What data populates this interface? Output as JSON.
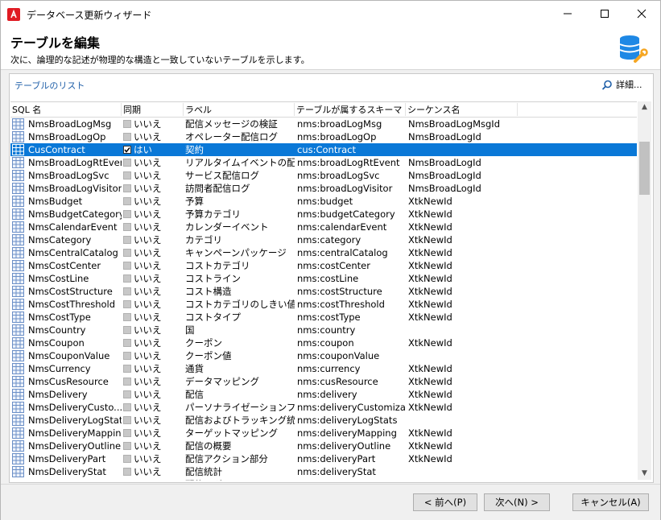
{
  "window": {
    "title": "データベース更新ウィザード",
    "accent_color": "#0a78d7",
    "app_icon": "adobe-icon"
  },
  "header": {
    "title": "テーブルを編集",
    "subtitle": "次に、論理的な記述が物理的な構造と一致していないテーブルを示します。",
    "icon": "database-wrench-icon"
  },
  "panel": {
    "list_label": "テーブルのリスト",
    "detail_label": "詳細...",
    "columns": [
      "SQL 名",
      "同期",
      "ラベル",
      "テーブルが属するスキーマ",
      "シーケンス名"
    ],
    "rows": [
      {
        "sql": "NmsBroadLogMsg",
        "sync": "いいえ",
        "checked": false,
        "label": "配信メッセージの検証",
        "schema": "nms:broadLogMsg",
        "seq": "NmsBroadLogMsgId"
      },
      {
        "sql": "NmsBroadLogOp",
        "sync": "いいえ",
        "checked": false,
        "label": "オペレーター配信ログ",
        "schema": "nms:broadLogOp",
        "seq": "NmsBroadLogId"
      },
      {
        "sql": "CusContract",
        "sync": "はい",
        "checked": true,
        "label": "契約",
        "schema": "cus:Contract",
        "seq": "",
        "selected": true
      },
      {
        "sql": "NmsBroadLogRtEvent",
        "sync": "いいえ",
        "checked": false,
        "label": "リアルタイムイベントの配...",
        "schema": "nms:broadLogRtEvent",
        "seq": "NmsBroadLogId"
      },
      {
        "sql": "NmsBroadLogSvc",
        "sync": "いいえ",
        "checked": false,
        "label": "サービス配信ログ",
        "schema": "nms:broadLogSvc",
        "seq": "NmsBroadLogId"
      },
      {
        "sql": "NmsBroadLogVisitor",
        "sync": "いいえ",
        "checked": false,
        "label": "訪問者配信ログ",
        "schema": "nms:broadLogVisitor",
        "seq": "NmsBroadLogId"
      },
      {
        "sql": "NmsBudget",
        "sync": "いいえ",
        "checked": false,
        "label": "予算",
        "schema": "nms:budget",
        "seq": "XtkNewId"
      },
      {
        "sql": "NmsBudgetCategory",
        "sync": "いいえ",
        "checked": false,
        "label": "予算カテゴリ",
        "schema": "nms:budgetCategory",
        "seq": "XtkNewId"
      },
      {
        "sql": "NmsCalendarEvent",
        "sync": "いいえ",
        "checked": false,
        "label": "カレンダーイベント",
        "schema": "nms:calendarEvent",
        "seq": "XtkNewId"
      },
      {
        "sql": "NmsCategory",
        "sync": "いいえ",
        "checked": false,
        "label": "カテゴリ",
        "schema": "nms:category",
        "seq": "XtkNewId"
      },
      {
        "sql": "NmsCentralCatalog",
        "sync": "いいえ",
        "checked": false,
        "label": "キャンペーンパッケージ",
        "schema": "nms:centralCatalog",
        "seq": "XtkNewId"
      },
      {
        "sql": "NmsCostCenter",
        "sync": "いいえ",
        "checked": false,
        "label": "コストカテゴリ",
        "schema": "nms:costCenter",
        "seq": "XtkNewId"
      },
      {
        "sql": "NmsCostLine",
        "sync": "いいえ",
        "checked": false,
        "label": "コストライン",
        "schema": "nms:costLine",
        "seq": "XtkNewId"
      },
      {
        "sql": "NmsCostStructure",
        "sync": "いいえ",
        "checked": false,
        "label": "コスト構造",
        "schema": "nms:costStructure",
        "seq": "XtkNewId"
      },
      {
        "sql": "NmsCostThreshold",
        "sync": "いいえ",
        "checked": false,
        "label": "コストカテゴリのしきい値",
        "schema": "nms:costThreshold",
        "seq": "XtkNewId"
      },
      {
        "sql": "NmsCostType",
        "sync": "いいえ",
        "checked": false,
        "label": "コストタイプ",
        "schema": "nms:costType",
        "seq": "XtkNewId"
      },
      {
        "sql": "NmsCountry",
        "sync": "いいえ",
        "checked": false,
        "label": "国",
        "schema": "nms:country",
        "seq": ""
      },
      {
        "sql": "NmsCoupon",
        "sync": "いいえ",
        "checked": false,
        "label": "クーポン",
        "schema": "nms:coupon",
        "seq": "XtkNewId"
      },
      {
        "sql": "NmsCouponValue",
        "sync": "いいえ",
        "checked": false,
        "label": "クーポン値",
        "schema": "nms:couponValue",
        "seq": ""
      },
      {
        "sql": "NmsCurrency",
        "sync": "いいえ",
        "checked": false,
        "label": "通貨",
        "schema": "nms:currency",
        "seq": "XtkNewId"
      },
      {
        "sql": "NmsCusResource",
        "sync": "いいえ",
        "checked": false,
        "label": "データマッピング",
        "schema": "nms:cusResource",
        "seq": "XtkNewId"
      },
      {
        "sql": "NmsDelivery",
        "sync": "いいえ",
        "checked": false,
        "label": "配信",
        "schema": "nms:delivery",
        "seq": "XtkNewId"
      },
      {
        "sql": "NmsDeliveryCusto...",
        "sync": "いいえ",
        "checked": false,
        "label": "パーソナライゼーションフィール",
        "schema": "nms:deliveryCustomiza...",
        "seq": "XtkNewId"
      },
      {
        "sql": "NmsDeliveryLogStats",
        "sync": "いいえ",
        "checked": false,
        "label": "配信およびトラッキング統計",
        "schema": "nms:deliveryLogStats",
        "seq": ""
      },
      {
        "sql": "NmsDeliveryMapping",
        "sync": "いいえ",
        "checked": false,
        "label": "ターゲットマッピング",
        "schema": "nms:deliveryMapping",
        "seq": "XtkNewId"
      },
      {
        "sql": "NmsDeliveryOutline",
        "sync": "いいえ",
        "checked": false,
        "label": "配信の概要",
        "schema": "nms:deliveryOutline",
        "seq": "XtkNewId"
      },
      {
        "sql": "NmsDeliveryPart",
        "sync": "いいえ",
        "checked": false,
        "label": "配信アクション部分",
        "schema": "nms:deliveryPart",
        "seq": "XtkNewId"
      },
      {
        "sql": "NmsDeliveryStat",
        "sync": "いいえ",
        "checked": false,
        "label": "配信統計",
        "schema": "nms:deliveryStat",
        "seq": ""
      },
      {
        "sql": "",
        "sync": "",
        "checked": false,
        "label": "配信ログ",
        "schema": "",
        "seq": ""
      }
    ]
  },
  "footer": {
    "prev_label": "< 前へ(P)",
    "next_label": "次へ(N) >",
    "cancel_label": "キャンセル(A)"
  }
}
